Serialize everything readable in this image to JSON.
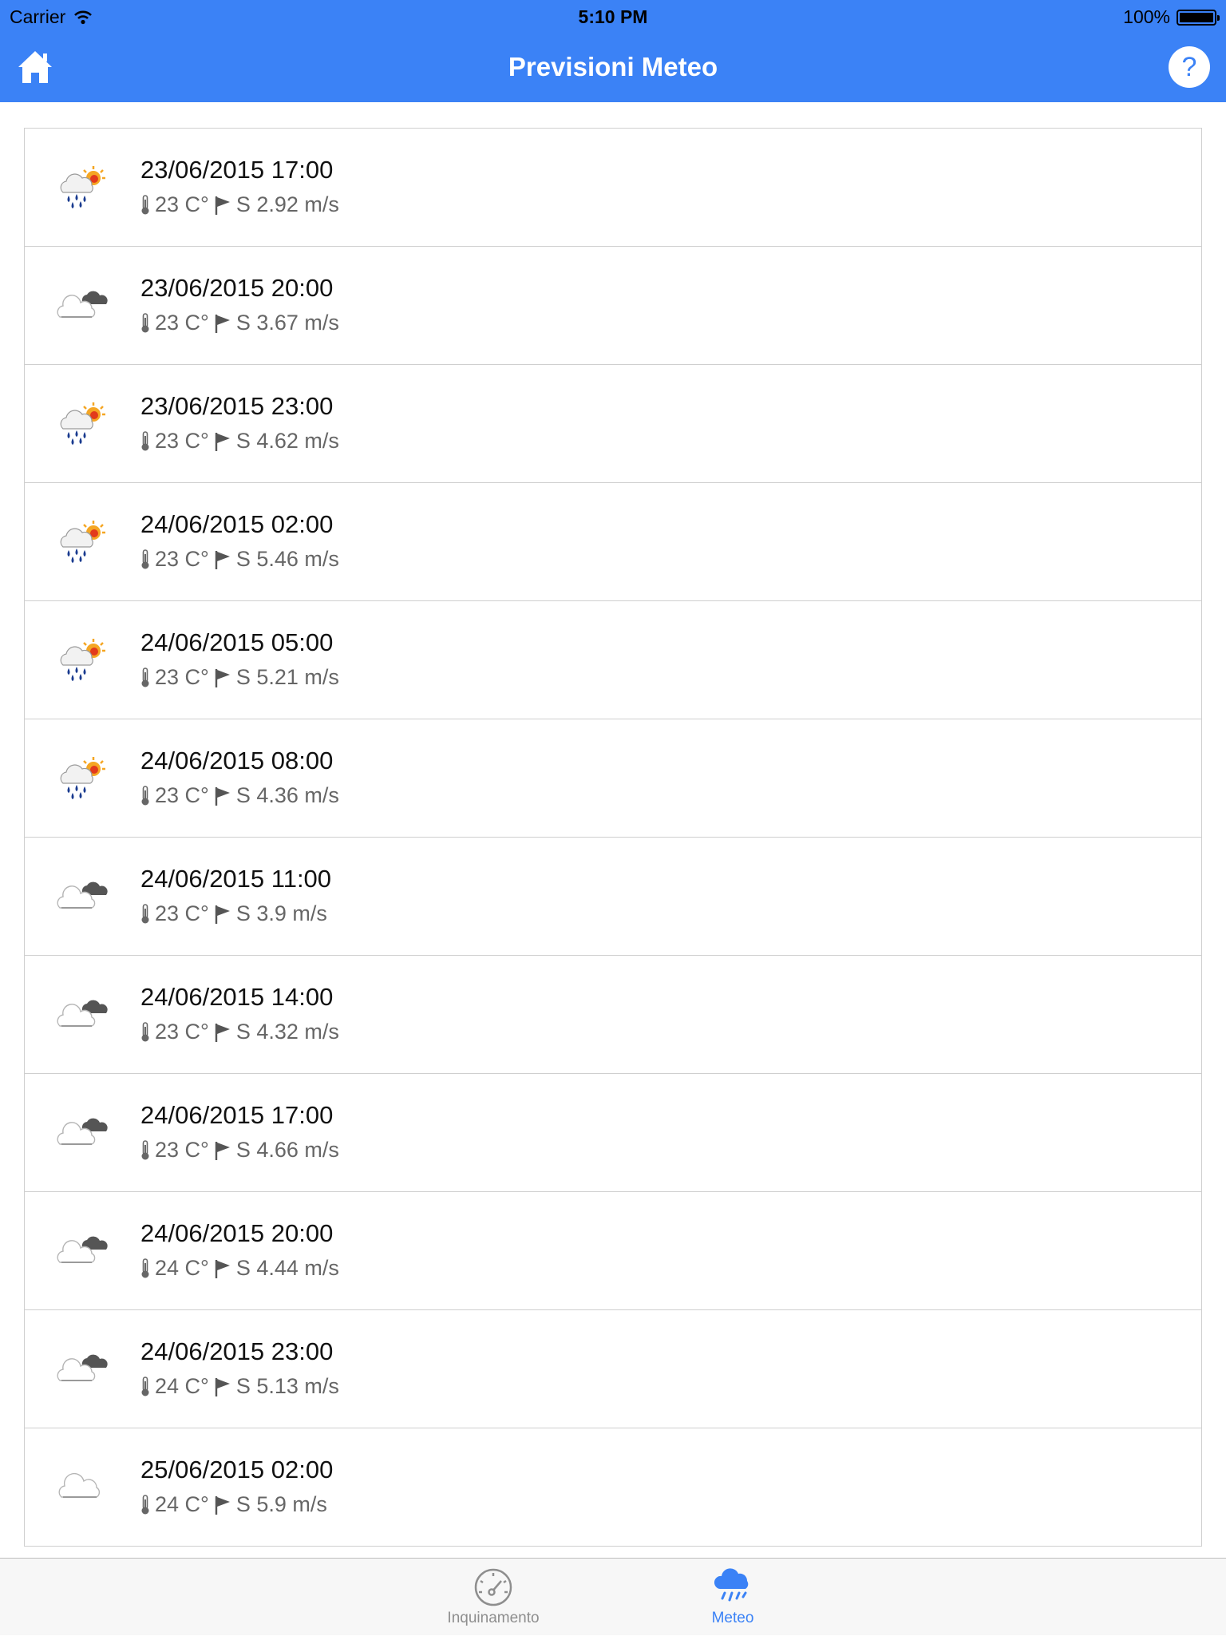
{
  "status_bar": {
    "carrier": "Carrier",
    "time": "5:10 PM",
    "battery": "100%"
  },
  "nav": {
    "title": "Previsioni Meteo",
    "help_label": "?"
  },
  "colors": {
    "accent": "#3b82f6",
    "text_secondary": "#666666",
    "divider": "#cfcfcf"
  },
  "forecast": [
    {
      "datetime": "23/06/2015 17:00",
      "temp": "23 C°",
      "wind": "S 2.92 m/s",
      "icon": "rain-sun-icon"
    },
    {
      "datetime": "23/06/2015 20:00",
      "temp": "23 C°",
      "wind": "S 3.67 m/s",
      "icon": "cloudy-icon"
    },
    {
      "datetime": "23/06/2015 23:00",
      "temp": "23 C°",
      "wind": "S 4.62 m/s",
      "icon": "rain-sun-icon"
    },
    {
      "datetime": "24/06/2015 02:00",
      "temp": "23 C°",
      "wind": "S 5.46 m/s",
      "icon": "rain-sun-icon"
    },
    {
      "datetime": "24/06/2015 05:00",
      "temp": "23 C°",
      "wind": "S 5.21 m/s",
      "icon": "rain-sun-icon"
    },
    {
      "datetime": "24/06/2015 08:00",
      "temp": "23 C°",
      "wind": "S 4.36 m/s",
      "icon": "rain-sun-icon"
    },
    {
      "datetime": "24/06/2015 11:00",
      "temp": "23 C°",
      "wind": "S 3.9 m/s",
      "icon": "cloudy-icon"
    },
    {
      "datetime": "24/06/2015 14:00",
      "temp": "23 C°",
      "wind": "S 4.32 m/s",
      "icon": "cloudy-icon"
    },
    {
      "datetime": "24/06/2015 17:00",
      "temp": "23 C°",
      "wind": "S 4.66 m/s",
      "icon": "cloudy-icon"
    },
    {
      "datetime": "24/06/2015 20:00",
      "temp": "24 C°",
      "wind": "S 4.44 m/s",
      "icon": "cloudy-icon"
    },
    {
      "datetime": "24/06/2015 23:00",
      "temp": "24 C°",
      "wind": "S 5.13 m/s",
      "icon": "cloudy-icon"
    },
    {
      "datetime": "25/06/2015 02:00",
      "temp": "24 C°",
      "wind": "S 5.9 m/s",
      "icon": "cloud-icon"
    }
  ],
  "tabs": [
    {
      "label": "Inquinamento",
      "icon": "speedometer-icon",
      "active": false
    },
    {
      "label": "Meteo",
      "icon": "rain-cloud-icon",
      "active": true
    }
  ]
}
